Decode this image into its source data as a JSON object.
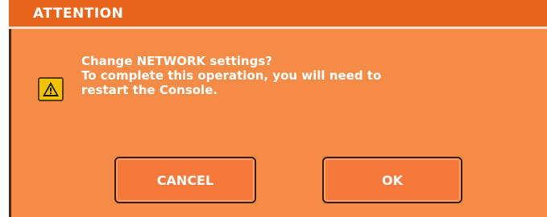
{
  "dialog": {
    "title": "ATTENTION",
    "icon": "warning-icon",
    "message_lines": [
      "Change NETWORK settings?",
      "To complete this operation, you will need to",
      "restart the Console."
    ],
    "buttons": {
      "cancel_label": "CANCEL",
      "ok_label": "OK"
    },
    "colors": {
      "body": "#f48c48",
      "title_bar": "#e9651b",
      "button": "#f4793a",
      "icon": "#f2c200",
      "text": "#ffffff"
    }
  }
}
